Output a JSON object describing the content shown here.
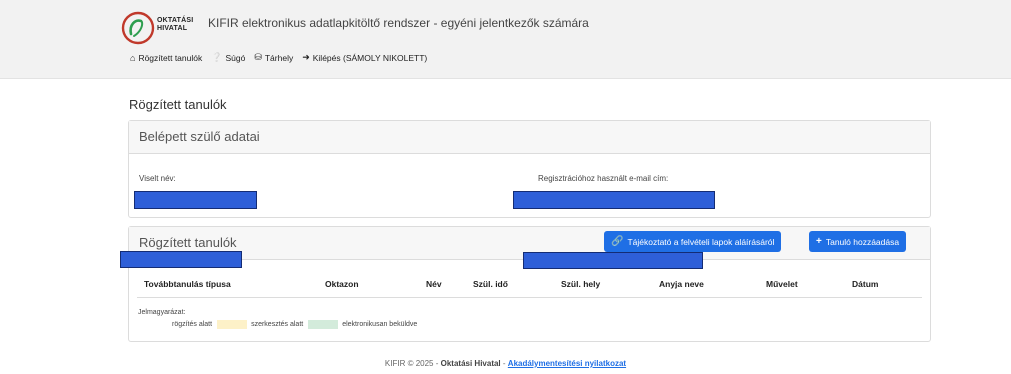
{
  "header": {
    "logo_line1": "OKTATÁSI",
    "logo_line2": "HIVATAL",
    "app_title": "KIFIR elektronikus adatlapkitöltő rendszer - egyéni jelentkezők számára",
    "nav": [
      {
        "label": "Rögzített tanulók",
        "icon": "home-icon"
      },
      {
        "label": "Súgó",
        "icon": "question-icon"
      },
      {
        "label": "Tárhely",
        "icon": "storage-icon"
      },
      {
        "label": "Kilépés (SÁMOLY NIKOLETT)",
        "icon": "logout-icon"
      }
    ]
  },
  "page_title": "Rögzített tanulók",
  "parent_card": {
    "title": "Belépett szülő adatai",
    "name_label": "Viselt név:",
    "email_label": "Regisztrációhoz használt e-mail cím:"
  },
  "students_card": {
    "title": "Rögzített tanulók",
    "info_button": "Tájékoztató a felvételi lapok aláírásáról",
    "add_button": "Tanuló hozzáadása",
    "columns": [
      "Továbbtanulás típusa",
      "Oktazon",
      "Név",
      "Szül. idő",
      "Szül. hely",
      "Anyja neve",
      "Művelet",
      "Dátum"
    ],
    "legend_label": "Jelmagyarázat:",
    "legend": [
      {
        "label": "rögzítés alatt",
        "color": "#ffffff"
      },
      {
        "label": "szerkesztés alatt",
        "color": "#fdf1c8"
      },
      {
        "label": "elektronikusan beküldve",
        "color": "#d3ebdb"
      }
    ]
  },
  "colors": {
    "accent": "#1f6fe5",
    "redaction": "#2e5fd8"
  },
  "footer": {
    "copyright": "KIFIR © 2025 -",
    "org": "Oktatási Hivatal",
    "sep": "-",
    "link": "Akadálymentesítési nyilatkozat"
  }
}
